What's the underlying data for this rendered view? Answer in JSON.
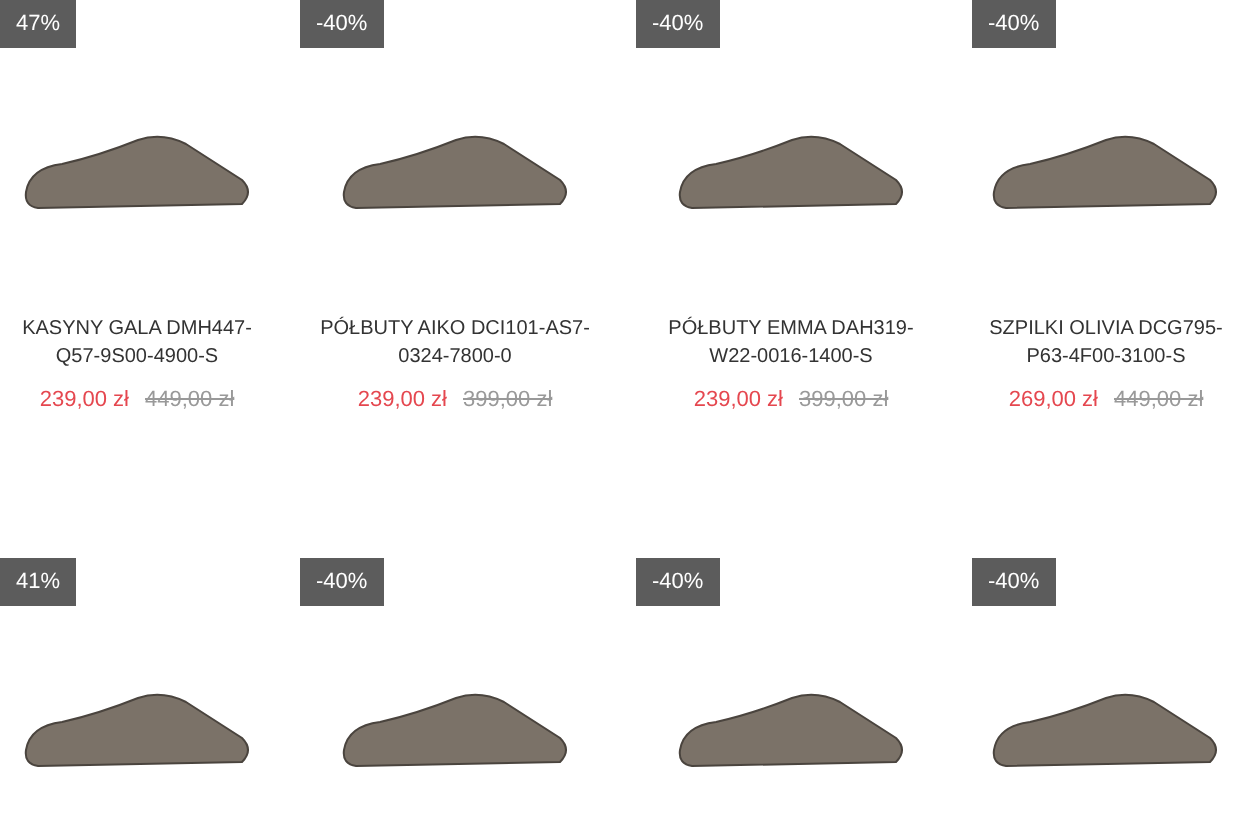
{
  "products": [
    {
      "badge": "47%",
      "name": "KASYNY GALA DMH447-Q57-9S00-4900-S",
      "price": "239,00 zł",
      "old_price": "449,00 zł"
    },
    {
      "badge": "-40%",
      "name": "PÓŁBUTY AIKO DCI101-AS7-0324-7800-0",
      "price": "239,00 zł",
      "old_price": "399,00 zł"
    },
    {
      "badge": "-40%",
      "name": "PÓŁBUTY EMMA DAH319-W22-0016-1400-S",
      "price": "239,00 zł",
      "old_price": "399,00 zł"
    },
    {
      "badge": "-40%",
      "name": "SZPILKI OLIVIA DCG795-P63-4F00-3100-S",
      "price": "269,00 zł",
      "old_price": "449,00 zł"
    },
    {
      "badge": "41%"
    },
    {
      "badge": "-40%"
    },
    {
      "badge": "-40%"
    },
    {
      "badge": "-40%"
    }
  ]
}
